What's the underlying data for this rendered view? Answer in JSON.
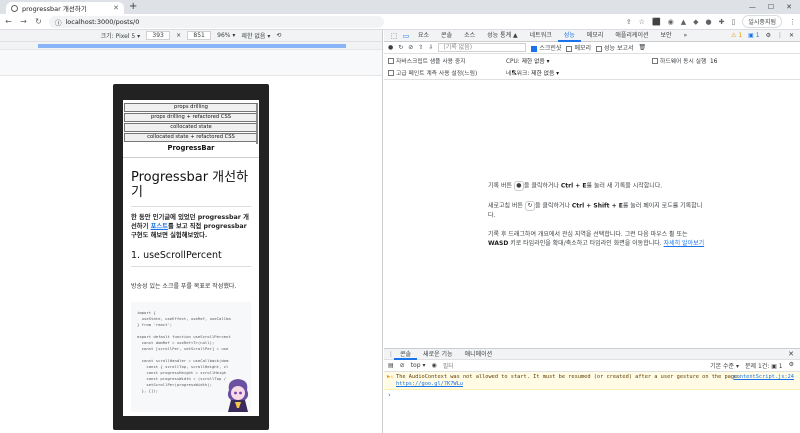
{
  "browser": {
    "tab_title": "progressbar 개선하기",
    "url": "localhost:3000/posts/0",
    "profile_label": "일시중지됨"
  },
  "device_toolbar": {
    "device": "크기: Pixel 5 ▾",
    "width": "393",
    "height": "851",
    "zoom": "96% ▾",
    "throttle": "제한 없음 ▾"
  },
  "page": {
    "nav_items": [
      "props drilling",
      "props drilling + refactored CSS",
      "collocated state",
      "collocated state + refactored CSS"
    ],
    "nav_title": "ProgressBar",
    "heading": "Progressbar 개선하기",
    "intro_before": "한 동안 인기글에 있었던 progressbar 개선하기 ",
    "intro_link": "포스트",
    "intro_after": "를 보고 직접 progressbar 구현도 해보면 실험해보았다.",
    "section_title": "1. useScrollPercent",
    "paragraph": "방송성 있는 소크를 푸를 목표로 작성했다.",
    "code_lines": [
      "import {",
      "  useState, useEffect, useRef, useCallba",
      "} from 'react';",
      "",
      "export default function useScrollPercent",
      "  const domRef = useRef<T>(null);",
      "  const [scrollPer, setScrollPer] = use",
      "",
      "  const scrollHandler = useCallback(dom",
      "    const { scrollTop, scrollHeight, cl",
      "    const progressHeight = scrollHeigh",
      "    const progressWidth = (scrollTop /",
      "    setScrollPer(progressWidth);",
      "  }, []);"
    ]
  },
  "devtools": {
    "tabs": [
      "요소",
      "콘솔",
      "소스",
      "성능 통계 ▲",
      "네트워크",
      "성능",
      "메모리",
      "애플리케이션",
      "보안",
      "»"
    ],
    "active_tab": "성능",
    "warn_count": "⚠ 1",
    "msg_count": "1",
    "perf_toolbar": {
      "profile_placeholder": "(기록 없음)",
      "screenshot_label": "스크린샷",
      "memory_label": "메모리",
      "web_vitals_label": "성능 보고서"
    },
    "settings": {
      "js_samples": "자바스크립트 샘플 사용 중지",
      "cpu_label": "CPU:",
      "cpu_value": "제한 없음 ▾",
      "hw_concurrency": "하드웨어 동시 실행",
      "hw_value": "16",
      "paint_instr": "고급 페인트 계측 사용 설정(느림)",
      "network_label": "네트워크:",
      "network_value": "제한 없음 ▾"
    },
    "landing": {
      "p1_before": "기록 버튼",
      "p1_after": "을 클릭하거나 ",
      "p1_key": "Ctrl + E",
      "p1_end": "를 눌러 새 기록을 시작합니다.",
      "p2_before": "새로고침 버튼",
      "p2_after": "을 클릭하거나 ",
      "p2_key": "Ctrl + Shift + E",
      "p2_end": "를 눌러 페이지 로드를 기록합니다.",
      "p3_text": "기록 후 드래그하여 개요에서 관심 지역을 선택합니다. 그런 다음 마우스 휠 또는 ",
      "p3_key": "WASD",
      "p3_after": " 키로 타임라인을 확대/축소하고 타임라인 화면을 이동합니다. ",
      "p3_link": "자세히 알아보기"
    },
    "drawer": {
      "tabs": [
        "콘솔",
        "새로운 기능",
        "애니메이션"
      ],
      "context": "top ▾",
      "filter_placeholder": "필터",
      "levels": "기본 수준 ▾",
      "issues": "문제 1건: ▣ 1",
      "warning_text": "The AudioContext was not allowed to start. It must be resumed (or created) after a user gesture on the page.",
      "warning_link": "https://goo.gl/7K7WLu",
      "warning_source": "contentScript.js:24"
    }
  }
}
